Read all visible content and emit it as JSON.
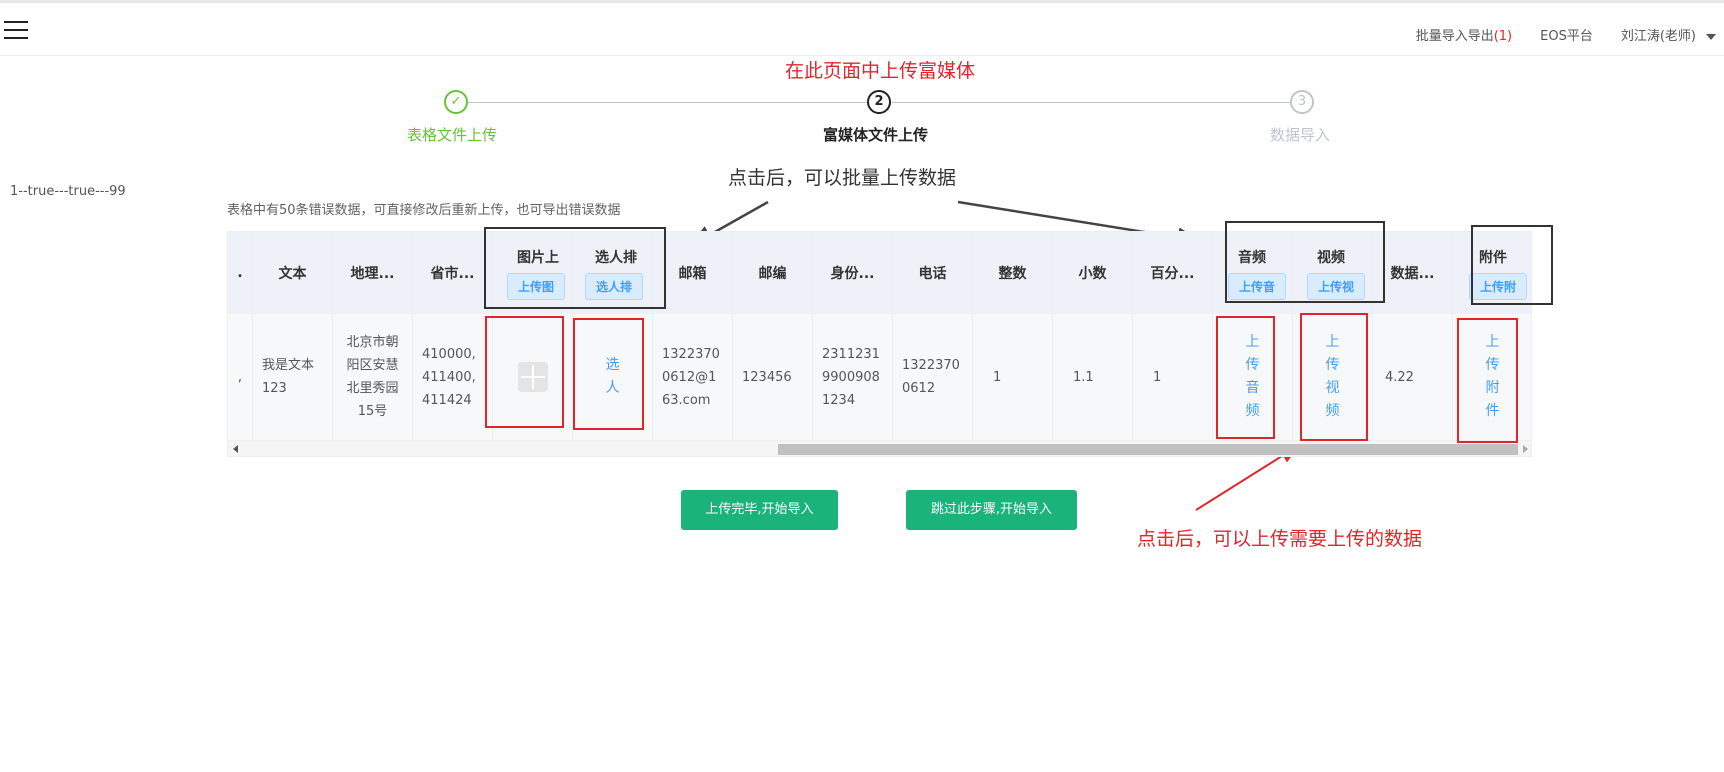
{
  "topbar": {
    "nav_items": [
      {
        "label": "批量导入导出",
        "count": "(1)"
      },
      {
        "label": "EOS平台"
      },
      {
        "label": "刘江涛(老师)"
      }
    ]
  },
  "annotations": {
    "top_note": "在此页面中上传富媒体",
    "batch_note": "点击后，可以批量上传数据",
    "upload_note": "点击后，可以上传需要上传的数据"
  },
  "steps": [
    {
      "number": "✓",
      "label": "表格文件上传",
      "status": "done"
    },
    {
      "number": "2",
      "label": "富媒体文件上传",
      "status": "active"
    },
    {
      "number": "3",
      "label": "数据导入",
      "status": "pending"
    }
  ],
  "debug_text": "1--true---true---99",
  "info_text": "表格中有50条错误数据，可直接修改后重新上传，也可导出错误数据",
  "table": {
    "headers": {
      "col0": ".",
      "text": "文本",
      "address": "地理...",
      "province": "省市...",
      "image": "图片上",
      "image_btn": "上传图",
      "select_person": "选人排",
      "select_person_btn": "选人排",
      "email": "邮箱",
      "zip": "邮编",
      "id_card": "身份...",
      "phone": "电话",
      "integer": "整数",
      "decimal": "小数",
      "percent": "百分...",
      "audio": "音频",
      "audio_btn": "上传音",
      "video": "视频",
      "video_btn": "上传视",
      "data": "数据...",
      "attachment": "附件",
      "attachment_btn": "上传附"
    },
    "row": {
      "col0": ",",
      "text": "我是文本123",
      "address": "北京市朝阳区安慧北里秀园15号",
      "province": "410000,411400,411424",
      "select_person": "选人",
      "email": "13223700612@163.com",
      "zip": "123456",
      "id_card": "231123199009081234",
      "phone": "13223700612",
      "integer": "1",
      "decimal": "1.1",
      "percent": "1",
      "audio": "上传音频",
      "video": "上传视频",
      "data": "4.22",
      "attachment": "上传附件"
    }
  },
  "buttons": {
    "finish": "上传完毕,开始导入",
    "skip": "跳过此步骤,开始导入"
  },
  "colors": {
    "accent_green": "#1ab379",
    "step_done": "#67c23a",
    "link_blue": "#409eff",
    "annotation_red": "#e0262b"
  }
}
